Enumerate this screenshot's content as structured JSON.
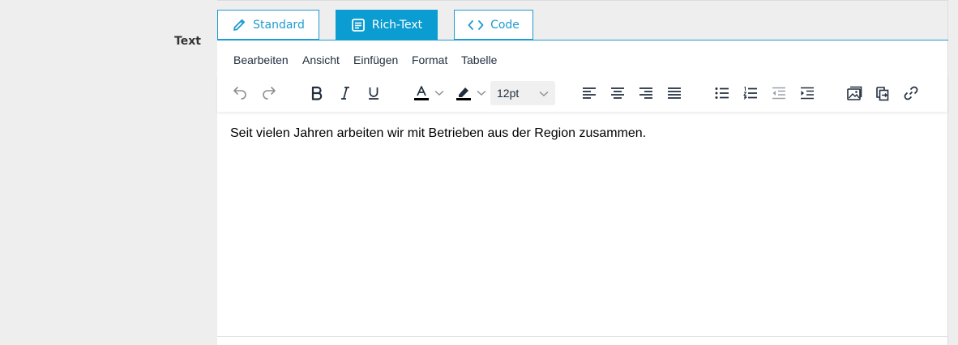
{
  "field_label": "Text",
  "tabs": [
    {
      "label": "Standard",
      "icon": "pencil-icon",
      "active": false
    },
    {
      "label": "Rich-Text",
      "icon": "document-icon",
      "active": true
    },
    {
      "label": "Code",
      "icon": "code-icon",
      "active": false
    }
  ],
  "menubar": [
    "Bearbeiten",
    "Ansicht",
    "Einfügen",
    "Format",
    "Tabelle"
  ],
  "toolbar": {
    "font_size": "12pt",
    "icons": [
      "undo-icon",
      "redo-icon",
      "bold-icon",
      "italic-icon",
      "underline-icon",
      "text-color-icon",
      "highlight-icon",
      "align-left-icon",
      "align-center-icon",
      "align-right-icon",
      "align-justify-icon",
      "bullet-list-icon",
      "numbered-list-icon",
      "outdent-icon",
      "indent-icon",
      "image-icon",
      "copy-icon",
      "link-icon"
    ]
  },
  "content": {
    "text": "Seit vielen Jahren arbeiten wir mit Betrieben aus der Region zusammen."
  },
  "colors": {
    "accent": "#0b9dd1",
    "text": "#222f3e",
    "background": "#eeeeee"
  }
}
